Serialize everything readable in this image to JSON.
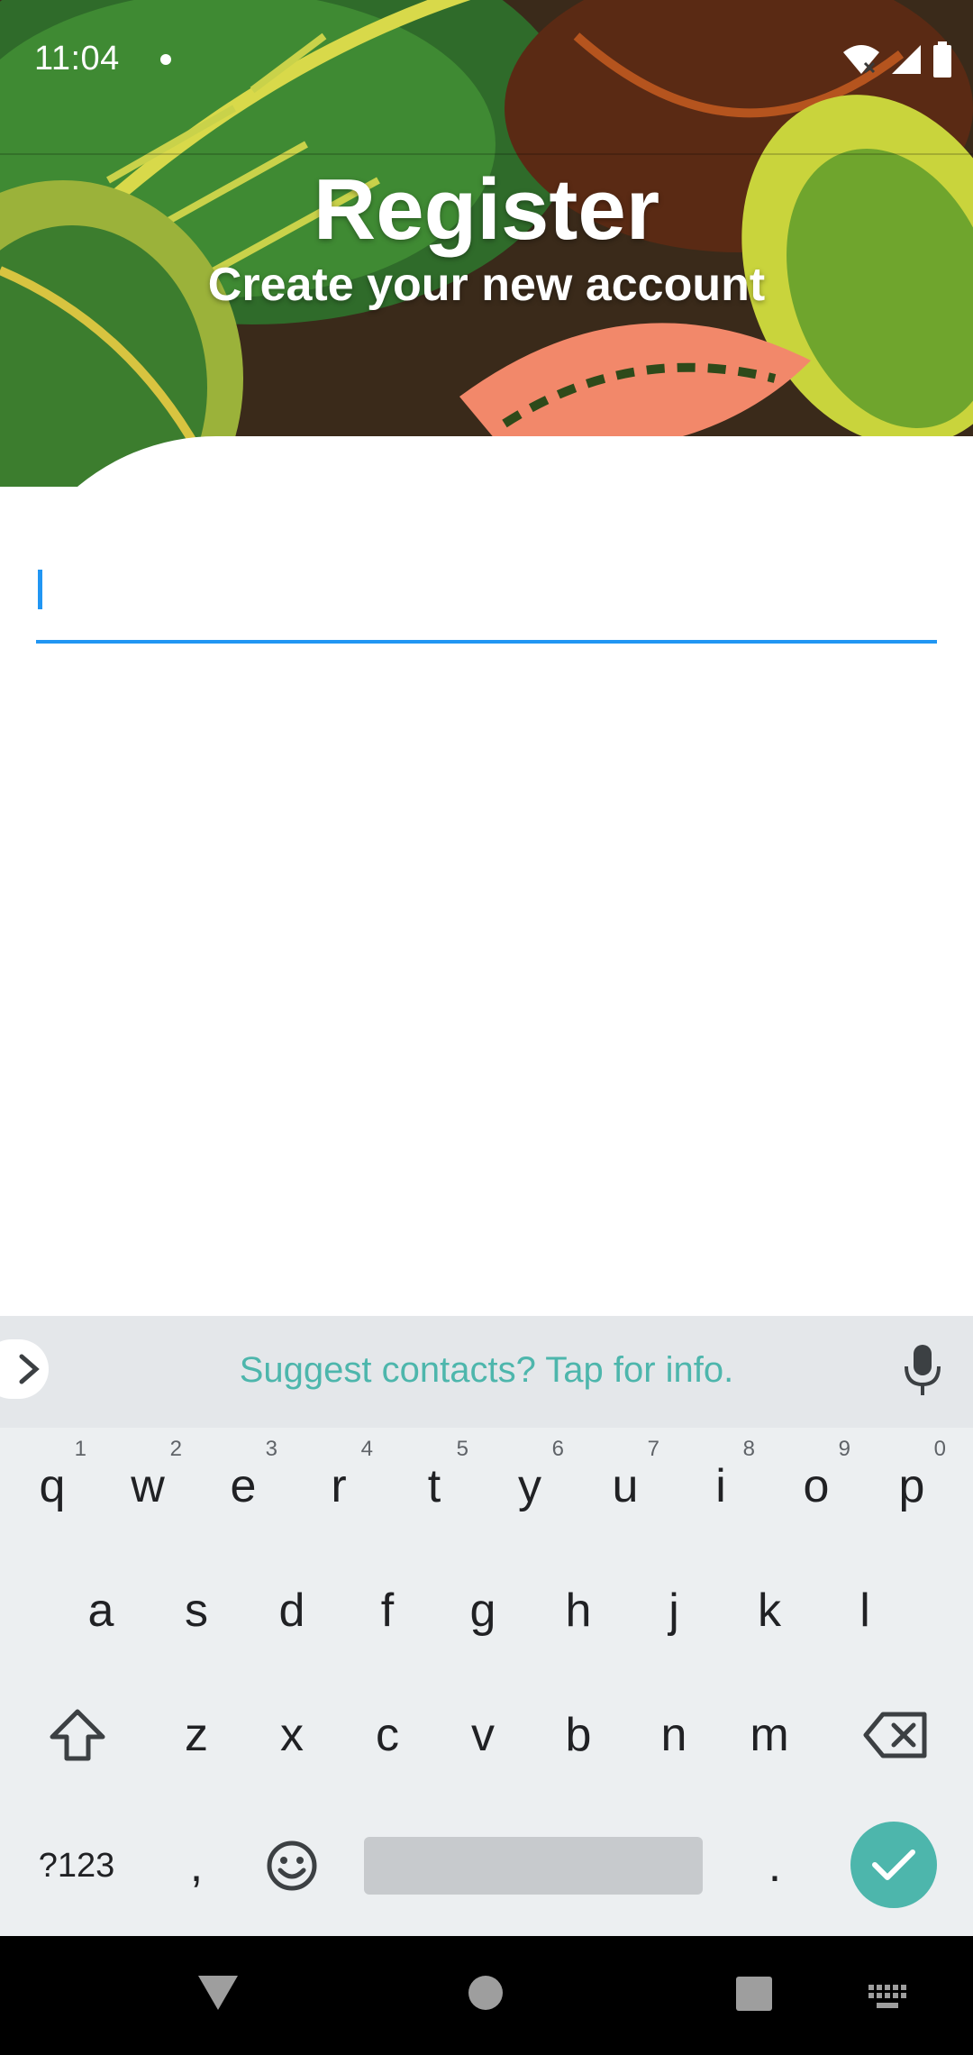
{
  "status_bar": {
    "time": "11:04"
  },
  "header": {
    "title": "Register",
    "subtitle": "Create your new account"
  },
  "form": {
    "input_value": ""
  },
  "keyboard": {
    "suggestion": "Suggest contacts? Tap for info.",
    "row1": [
      {
        "label": "q",
        "hint": "1"
      },
      {
        "label": "w",
        "hint": "2"
      },
      {
        "label": "e",
        "hint": "3"
      },
      {
        "label": "r",
        "hint": "4"
      },
      {
        "label": "t",
        "hint": "5"
      },
      {
        "label": "y",
        "hint": "6"
      },
      {
        "label": "u",
        "hint": "7"
      },
      {
        "label": "i",
        "hint": "8"
      },
      {
        "label": "o",
        "hint": "9"
      },
      {
        "label": "p",
        "hint": "0"
      }
    ],
    "row2": [
      "a",
      "s",
      "d",
      "f",
      "g",
      "h",
      "j",
      "k",
      "l"
    ],
    "row3": [
      "z",
      "x",
      "c",
      "v",
      "b",
      "n",
      "m"
    ],
    "symbols_label": "?123",
    "comma_label": ",",
    "period_label": "."
  },
  "colors": {
    "accent": "#2196F3",
    "keyboard_accent": "#4DB6AC"
  }
}
